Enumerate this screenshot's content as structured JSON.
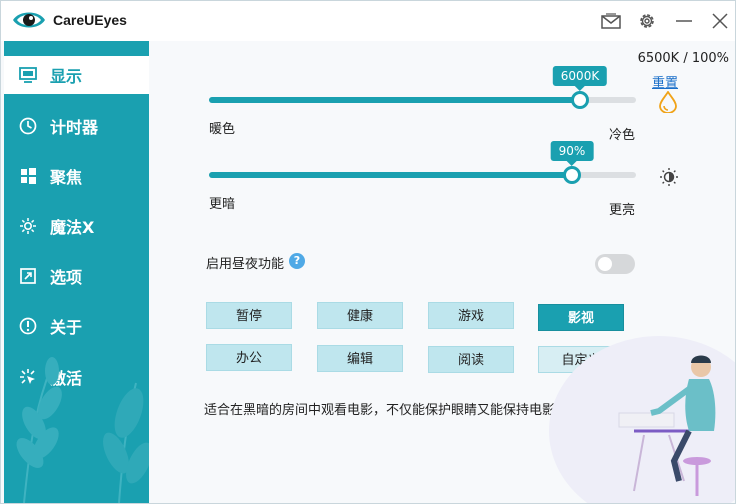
{
  "app": {
    "title": "CareUEyes"
  },
  "titlebar": {
    "icons": [
      "mail-icon",
      "gear-icon",
      "minimize-icon",
      "close-icon"
    ]
  },
  "sidebar": {
    "items": [
      {
        "label": "显示",
        "icon": "monitor-icon",
        "active": true
      },
      {
        "label": "计时器",
        "icon": "clock-icon",
        "active": false
      },
      {
        "label": "聚焦",
        "icon": "windows-icon",
        "active": false
      },
      {
        "label": "魔法X",
        "icon": "sparkle-icon",
        "active": false
      },
      {
        "label": "选项",
        "icon": "options-icon",
        "active": false
      },
      {
        "label": "关于",
        "icon": "info-icon",
        "active": false
      },
      {
        "label": "激活",
        "icon": "activate-icon",
        "active": false
      }
    ]
  },
  "status": {
    "summary": "6500K / 100%",
    "reset_label": "重置"
  },
  "color_temp": {
    "value_label": "6000K",
    "level": 0.87,
    "min_label": "暖色",
    "max_label": "冷色"
  },
  "brightness": {
    "value_label": "90%",
    "level": 0.85,
    "min_label": "更暗",
    "max_label": "更亮"
  },
  "day_night": {
    "label": "启用昼夜功能",
    "help": "?",
    "enabled": false
  },
  "modes": [
    {
      "label": "暂停",
      "active": false
    },
    {
      "label": "健康",
      "active": false
    },
    {
      "label": "游戏",
      "active": false
    },
    {
      "label": "影视",
      "active": true
    },
    {
      "label": "办公",
      "active": false
    },
    {
      "label": "编辑",
      "active": false
    },
    {
      "label": "阅读",
      "active": false
    },
    {
      "label": "自定义",
      "active": false
    }
  ],
  "description": "适合在黑暗的房间中观看电影，不仅能保护眼睛又能保持电影的真实色彩",
  "colors": {
    "accent": "#1aa0b0",
    "mode_bg": "#bfe6ee",
    "link": "#1a6fc9"
  }
}
